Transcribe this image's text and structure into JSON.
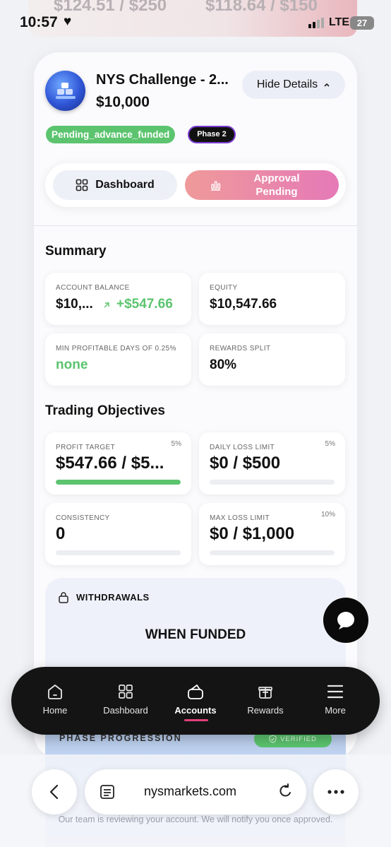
{
  "peek": {
    "left_value": "$124.51 / $250",
    "right_value": "$118.64 / $150"
  },
  "status_bar": {
    "time": "10:57",
    "network": "LTE",
    "battery": "27"
  },
  "account": {
    "title": "NYS Challenge - 2...",
    "size": "$10,000",
    "hide_details_label": "Hide Details",
    "status_badge": "Pending_advance_funded",
    "phase_badge": "Phase 2"
  },
  "tabs": {
    "dashboard_label": "Dashboard",
    "approval_label": "Approval Pending"
  },
  "summary": {
    "heading": "Summary",
    "account_balance": {
      "caption": "ACCOUNT BALANCE",
      "value": "$10,...",
      "change": "+$547.66"
    },
    "equity": {
      "caption": "EQUITY",
      "value": "$10,547.66"
    },
    "min_profitable_days": {
      "caption": "MIN PROFITABLE DAYS OF 0.25%",
      "value": "none"
    },
    "rewards_split": {
      "caption": "REWARDS SPLIT",
      "value": "80%"
    }
  },
  "objectives": {
    "heading": "Trading Objectives",
    "profit_target": {
      "caption": "PROFIT TARGET",
      "pct": "5%",
      "value": "$547.66 / $5...",
      "progress": 1.0
    },
    "daily_loss_limit": {
      "caption": "DAILY LOSS LIMIT",
      "pct": "5%",
      "value": "$0 / $500",
      "progress": 0
    },
    "consistency": {
      "caption": "CONSISTENCY",
      "value": "0",
      "progress": 0
    },
    "max_loss_limit": {
      "caption": "MAX LOSS LIMIT",
      "pct": "10%",
      "value": "$0 / $1,000",
      "progress": 0
    }
  },
  "withdrawals": {
    "heading": "WITHDRAWALS",
    "status": "WHEN FUNDED"
  },
  "phase_progression": {
    "label": "PHASE PROGRESSION",
    "badge": "VERIFIED"
  },
  "nav": {
    "items": [
      {
        "label": "Home",
        "icon": "home-icon"
      },
      {
        "label": "Dashboard",
        "icon": "grid-icon"
      },
      {
        "label": "Accounts",
        "icon": "wallet-icon"
      },
      {
        "label": "Rewards",
        "icon": "gift-icon"
      },
      {
        "label": "More",
        "icon": "menu-icon"
      }
    ],
    "active": "Accounts"
  },
  "review_message": "Our team is reviewing your account. We will notify you once approved.",
  "browser": {
    "url": "nysmarkets.com"
  },
  "colors": {
    "accent_green": "#5cc46f",
    "accent_pink": "#e0407a",
    "nav_bg": "#141414"
  }
}
